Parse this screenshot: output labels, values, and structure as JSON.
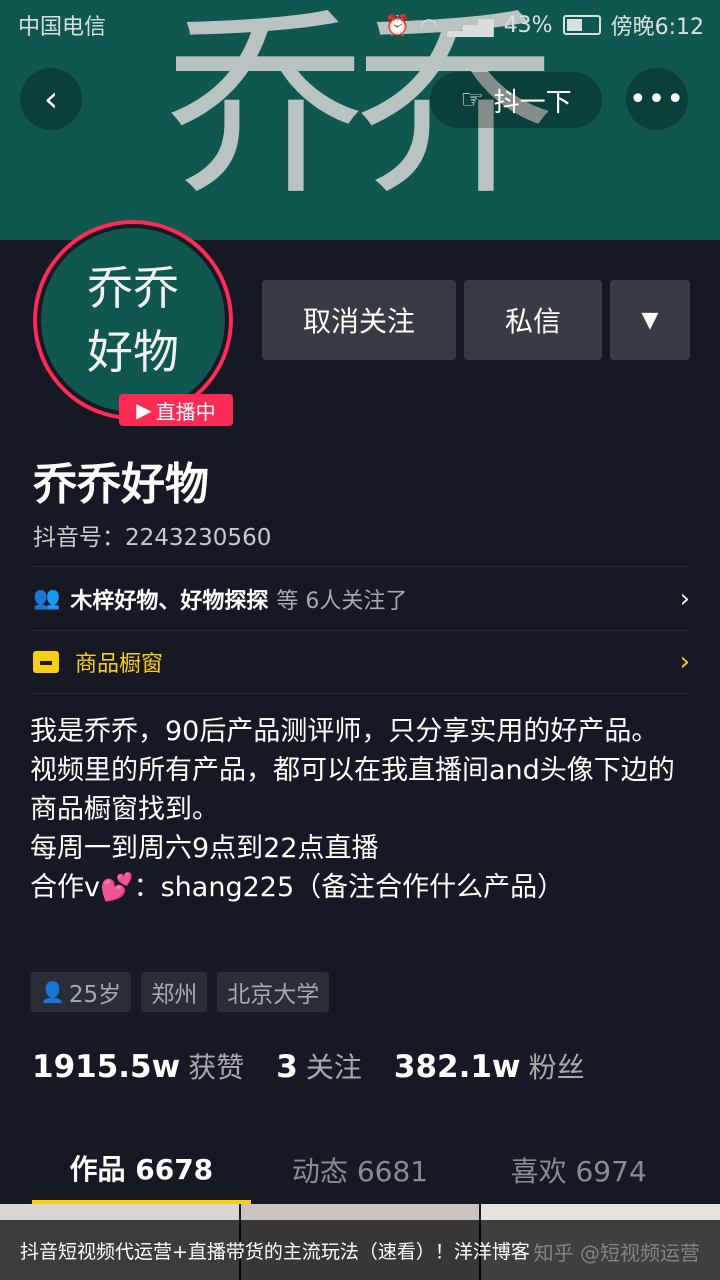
{
  "status_bar": {
    "carrier": "中国电信",
    "battery": "43%",
    "time": "傍晚6:12"
  },
  "banner": {
    "text": "乔乔"
  },
  "nav": {
    "back_icon": "chevron-left-icon",
    "shake_label": "抖一下",
    "more_icon": "ellipsis-icon"
  },
  "profile": {
    "avatar_line1": "乔乔",
    "avatar_line2": "好物",
    "live_badge": "直播中",
    "nickname": "乔乔好物",
    "douyin_id": "抖音号：2243230560"
  },
  "actions": {
    "unfollow": "取消关注",
    "message": "私信"
  },
  "followed_by": {
    "names": "木梓好物、好物探探",
    "rest": "等 6人关注了"
  },
  "shop": {
    "label": "商品橱窗"
  },
  "bio": {
    "line1": "我是乔乔，90后产品测评师，只分享实用的好产品。",
    "line2": "视频里的所有产品，都可以在我直播间and头像下边的商品橱窗找到。",
    "line3": "每周一到周六9点到22点直播",
    "line4_prefix": "合作v",
    "line4_suffix": "：shang225（备注合作什么产品）"
  },
  "tags": {
    "age": "25岁",
    "city": "郑州",
    "school": "北京大学"
  },
  "stats": {
    "likes": "1915.5w",
    "likes_label": "获赞",
    "following": "3",
    "following_label": "关注",
    "followers": "382.1w",
    "followers_label": "粉丝"
  },
  "tabs": {
    "works": "作品 6678",
    "dynamics": "动态 6681",
    "likes": "喜欢 6974"
  },
  "caption": "抖音短视频代运营+直播带货的主流玩法（速看）！洋洋博客",
  "watermark": "知乎 @短视频运营",
  "colors": {
    "background": "#161823",
    "accent_pink": "#fe2c55",
    "accent_yellow": "#face15",
    "banner": "#10584f"
  }
}
